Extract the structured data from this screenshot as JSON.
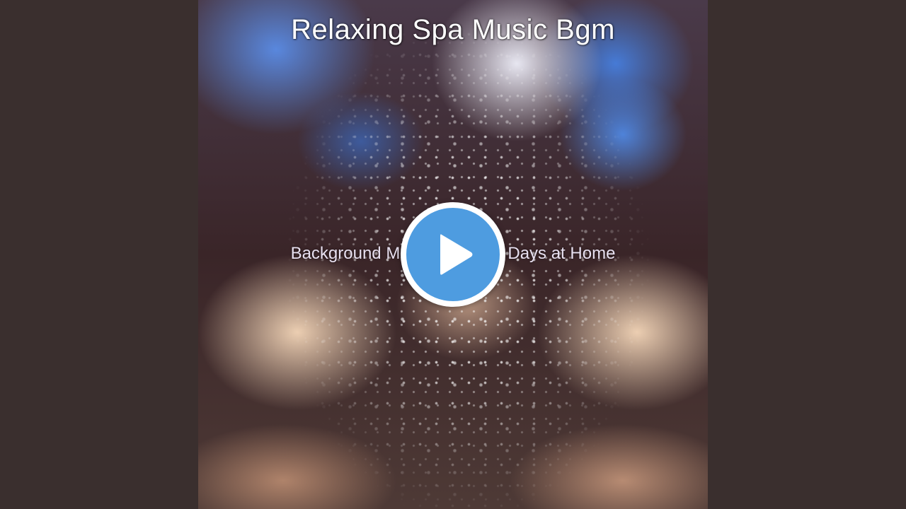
{
  "artwork": {
    "title": "Relaxing Spa Music Bgm",
    "subtitle": "Background Music for Rainy Days at Home"
  },
  "player": {
    "play_button": "play-icon",
    "accent_color": "#4e9ce0",
    "background_color": "#3a2f2e"
  }
}
